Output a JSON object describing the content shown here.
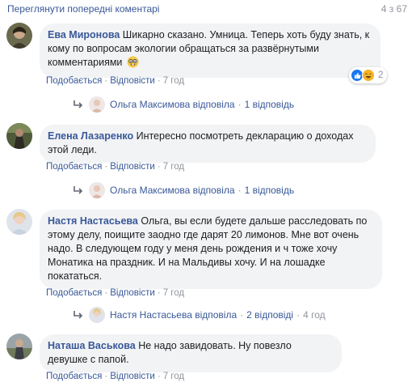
{
  "header": {
    "previous_comments_link": "Переглянути попередні коментарі",
    "count": "4 з 67"
  },
  "comments": [
    {
      "author": "Ева Миронова",
      "text": "Шикарно сказано. Умница. Теперь хоть буду знать, к кому по вопросам экологии обращаться за развёрнутыми комментариями",
      "emoji_icon": "nerd-face-emoji-icon",
      "actions": {
        "like": "Подобається",
        "reply": "Відповісти",
        "time": "7 год"
      },
      "reactions": {
        "icons": [
          "like",
          "haha"
        ],
        "count": "2"
      },
      "replies": {
        "author_link": "Ольга Максимова відповіла",
        "count_link": "1 відповідь"
      }
    },
    {
      "author": "Елена Лазаренко",
      "text": "Интересно посмотреть декларацию о доходах этой леди.",
      "actions": {
        "like": "Подобається",
        "reply": "Відповісти",
        "time": "7 год"
      },
      "replies": {
        "author_link": "Ольга Максимова відповіла",
        "count_link": "1 відповідь"
      }
    },
    {
      "author": "Настя Настасьева",
      "text": "Ольга, вы если будете дальше расследовать по этому делу, поищите заодно где дарят 20 лимонов. Мне вот очень надо. В следующем году у меня день рождения и ч тоже хочу Монатика на праздник. И на Мальдивы хочу. И на лошадке покататься.",
      "actions": {
        "like": "Подобається",
        "reply": "Відповісти",
        "time": "7 год"
      },
      "replies": {
        "author_link": "Настя Настасьева відповіла",
        "count_link": "2 відповіді",
        "time": "4 год"
      }
    },
    {
      "author": "Наташа Васькова",
      "text": "Не надо завидовать. Ну повезло девушке с папой.",
      "actions": {
        "like": "Подобається",
        "reply": "Відповісти",
        "time": "7 год"
      }
    }
  ],
  "colors": {
    "link": "#385898",
    "bubble": "#f2f3f5",
    "meta": "#90949c",
    "like_blue": "#1877f2",
    "haha_yellow": "#f7b125"
  }
}
